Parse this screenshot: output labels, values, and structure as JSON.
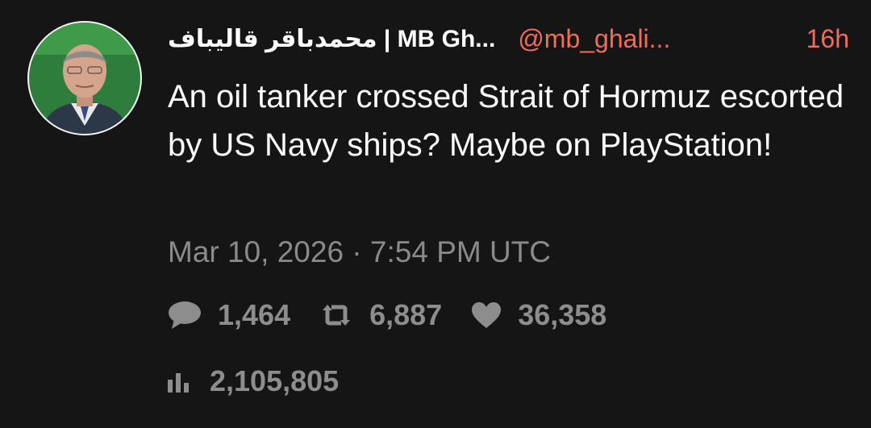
{
  "tweet": {
    "display_name": "محمدباقر قالیباف | MB Gh...",
    "handle": "@mb_ghali...",
    "time": "16h",
    "text": "An oil tanker crossed Strait of Hormuz escorted by US Navy ships? Maybe on PlayStation!",
    "timestamp": "Mar 10, 2026 · 7:54 PM UTC"
  },
  "stats": {
    "replies": "1,464",
    "retweets": "6,887",
    "likes": "36,358",
    "views": "2,105,805"
  },
  "icons": {
    "replies": "comment-icon",
    "retweets": "retweet-icon",
    "likes": "heart-icon",
    "views": "views-chart-icon"
  },
  "colors": {
    "background": "#151515",
    "accent": "#f36b5f",
    "muted": "#8d8d8d",
    "text": "#ffffff"
  }
}
